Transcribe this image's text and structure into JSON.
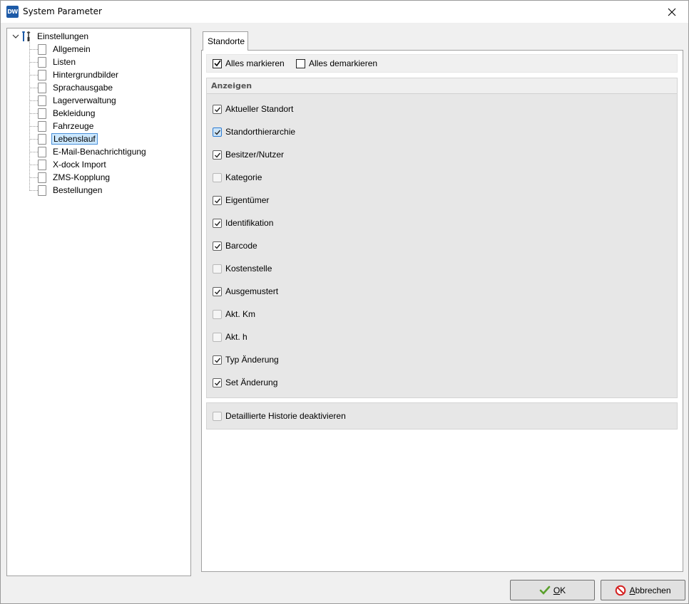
{
  "window": {
    "title": "System Parameter",
    "app_icon_text": "DW"
  },
  "tree": {
    "root_label": "Einstellungen",
    "items": [
      {
        "label": "Allgemein",
        "selected": false
      },
      {
        "label": "Listen",
        "selected": false
      },
      {
        "label": "Hintergrundbilder",
        "selected": false
      },
      {
        "label": "Sprachausgabe",
        "selected": false
      },
      {
        "label": "Lagerverwaltung",
        "selected": false
      },
      {
        "label": "Bekleidung",
        "selected": false
      },
      {
        "label": "Fahrzeuge",
        "selected": false
      },
      {
        "label": "Lebenslauf",
        "selected": true
      },
      {
        "label": "E-Mail-Benachrichtigung",
        "selected": false
      },
      {
        "label": "X-dock Import",
        "selected": false
      },
      {
        "label": "ZMS-Kopplung",
        "selected": false
      },
      {
        "label": "Bestellungen",
        "selected": false
      }
    ]
  },
  "tab": {
    "label": "Standorte"
  },
  "toolbar": {
    "mark_all": "Alles markieren",
    "unmark_all": "Alles demarkieren"
  },
  "group": {
    "header": "Anzeigen",
    "options": [
      {
        "label": "Aktueller Standort",
        "checked": true
      },
      {
        "label": "Standorthierarchie",
        "checked": true,
        "focused": true
      },
      {
        "label": "Besitzer/Nutzer",
        "checked": true
      },
      {
        "label": "Kategorie",
        "checked": false
      },
      {
        "label": "Eigentümer",
        "checked": true
      },
      {
        "label": "Identifikation",
        "checked": true
      },
      {
        "label": "Barcode",
        "checked": true
      },
      {
        "label": "Kostenstelle",
        "checked": false
      },
      {
        "label": "Ausgemustert",
        "checked": true
      },
      {
        "label": "Akt. Km",
        "checked": false
      },
      {
        "label": "Akt. h",
        "checked": false
      },
      {
        "label": "Typ Änderung",
        "checked": true
      },
      {
        "label": "Set Änderung",
        "checked": true
      }
    ]
  },
  "history": {
    "label": "Detaillierte Historie deaktivieren",
    "checked": false
  },
  "buttons": {
    "ok_mnemonic": "O",
    "ok_rest": "K",
    "cancel_mnemonic": "A",
    "cancel_rest": "bbrechen"
  },
  "colors": {
    "ok_icon": "#5aa02c",
    "cancel_icon": "#d42020",
    "selection": "#cce8ff"
  }
}
